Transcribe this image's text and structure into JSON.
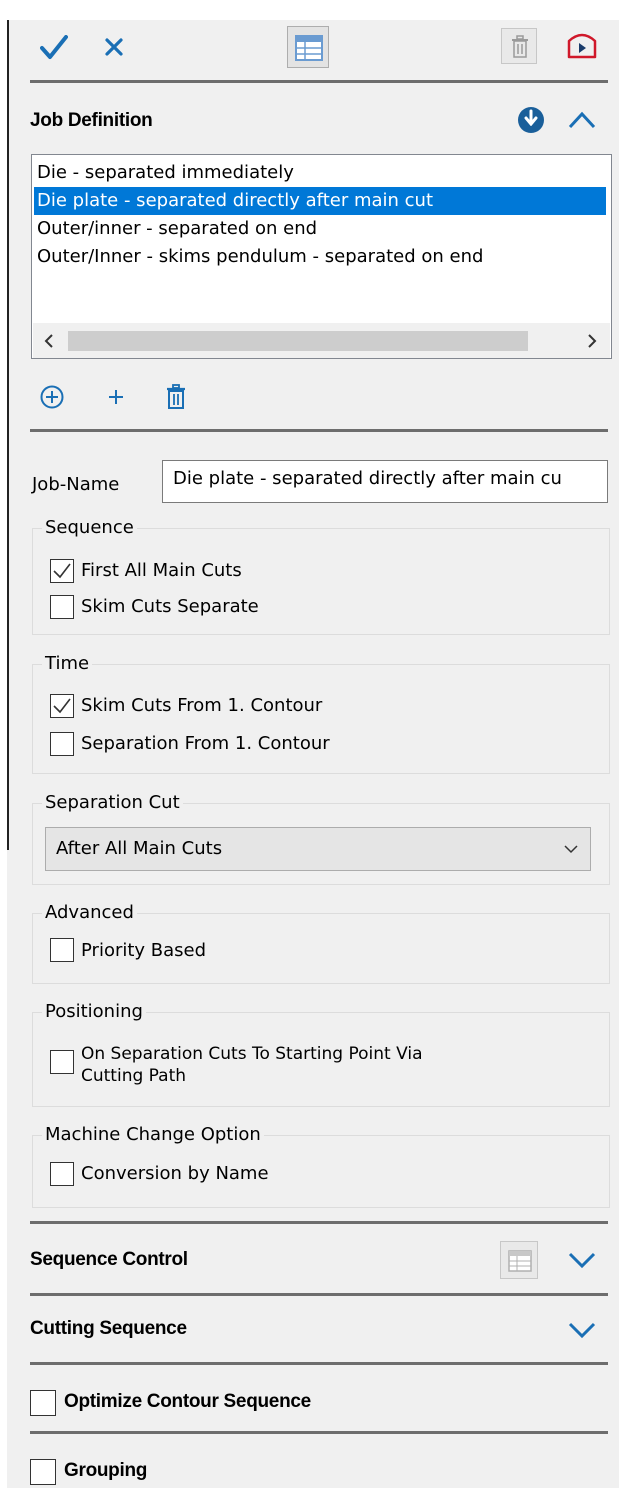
{
  "colors": {
    "accent": "#0078d7",
    "icon_blue": "#1a6fb5",
    "trash_red": "#d0182a"
  },
  "toolbar": {
    "ok_icon": "checkmark-icon",
    "cancel_icon": "close-icon",
    "table_icon": "table-icon",
    "delete_icon": "trash-icon",
    "exit_icon": "exit-icon"
  },
  "job_definition": {
    "title": "Job Definition",
    "jobs": [
      "Die - separated immediately",
      "Die plate - separated directly after main cut",
      "Outer/inner - separated on end",
      "Outer/Inner - skims pendulum - separated on end"
    ],
    "selected_index": 1,
    "job_name_label": "Job-Name",
    "job_name_value": "Die plate - separated directly after main cu"
  },
  "sequence": {
    "title": "Sequence",
    "first_all_main_cuts": {
      "label": "First All Main Cuts",
      "checked": true
    },
    "skim_cuts_separate": {
      "label": "Skim Cuts Separate",
      "checked": false
    }
  },
  "time": {
    "title": "Time",
    "skim_cuts_from_contour": {
      "label": "Skim Cuts From 1. Contour",
      "checked": true
    },
    "separation_from_contour": {
      "label": "Separation From 1. Contour",
      "checked": false
    }
  },
  "separation_cut": {
    "title": "Separation Cut",
    "selected": "After All Main Cuts"
  },
  "advanced": {
    "title": "Advanced",
    "priority_based": {
      "label": "Priority Based",
      "checked": false
    }
  },
  "positioning": {
    "title": "Positioning",
    "option": {
      "label_line1": "On Separation Cuts To Starting Point Via",
      "label_line2": "Cutting Path",
      "checked": false
    }
  },
  "machine_change": {
    "title": "Machine Change Option",
    "conversion_by_name": {
      "label": "Conversion by Name",
      "checked": false
    }
  },
  "sequence_control": {
    "title": "Sequence Control"
  },
  "cutting_sequence": {
    "title": "Cutting Sequence"
  },
  "optimize_contour_sequence": {
    "label": "Optimize Contour Sequence",
    "checked": false
  },
  "grouping": {
    "label": "Grouping",
    "checked": false
  }
}
